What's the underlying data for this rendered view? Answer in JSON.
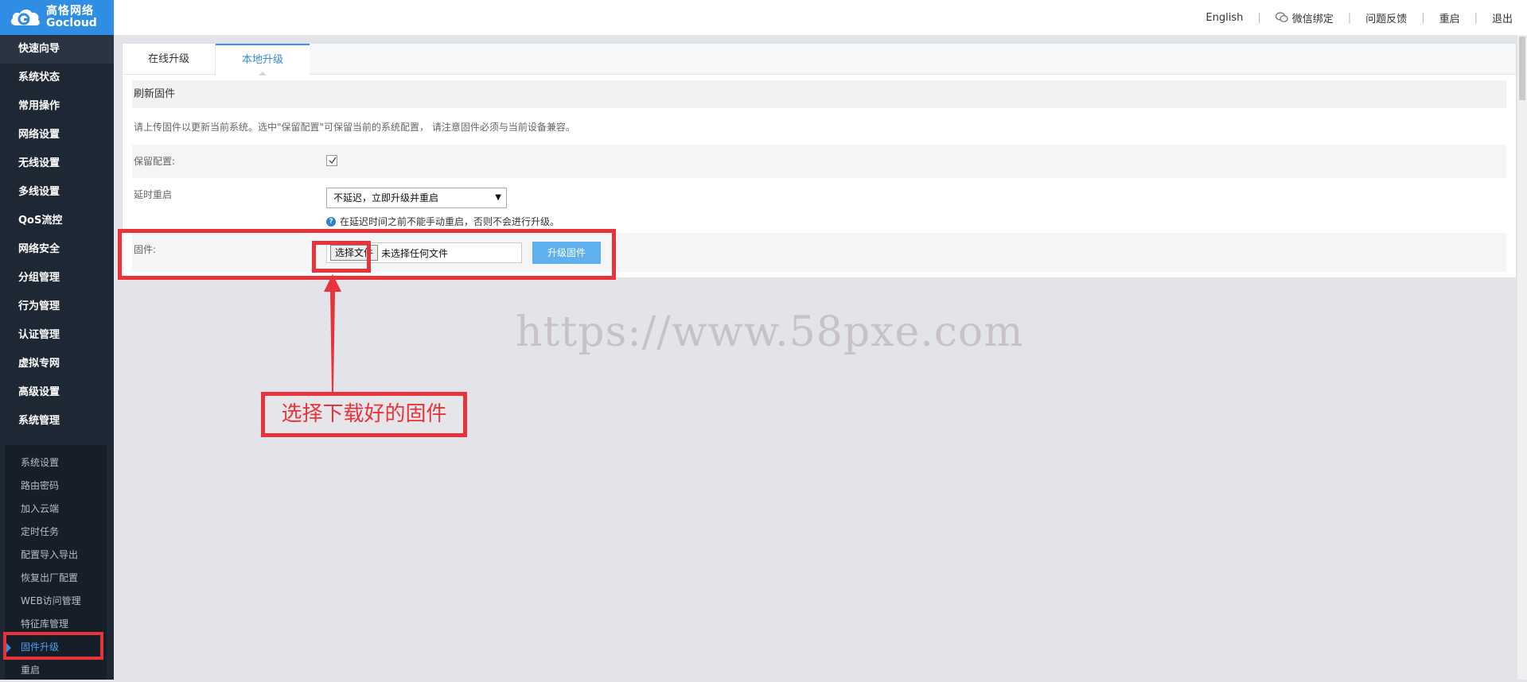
{
  "logo": {
    "cn": "高恪网络",
    "en": "Gocloud"
  },
  "sidebar": {
    "items": [
      {
        "label": "快速向导"
      },
      {
        "label": "系统状态"
      },
      {
        "label": "常用操作"
      },
      {
        "label": "网络设置"
      },
      {
        "label": "无线设置"
      },
      {
        "label": "多线设置"
      },
      {
        "label": "QoS流控"
      },
      {
        "label": "网络安全"
      },
      {
        "label": "分组管理"
      },
      {
        "label": "行为管理"
      },
      {
        "label": "认证管理"
      },
      {
        "label": "虚拟专网"
      },
      {
        "label": "高级设置"
      },
      {
        "label": "系统管理"
      }
    ],
    "subitems": [
      {
        "label": "系统设置"
      },
      {
        "label": "路由密码"
      },
      {
        "label": "加入云端"
      },
      {
        "label": "定时任务"
      },
      {
        "label": "配置导入导出"
      },
      {
        "label": "恢复出厂配置"
      },
      {
        "label": "WEB访问管理"
      },
      {
        "label": "特征库管理"
      },
      {
        "label": "固件升级"
      },
      {
        "label": "重启"
      }
    ]
  },
  "header": {
    "english": "English",
    "wechat": "微信绑定",
    "feedback": "问题反馈",
    "reboot": "重启",
    "logout": "退出",
    "separator": "|"
  },
  "tabs": {
    "online": "在线升级",
    "local": "本地升级"
  },
  "section": {
    "title": "刷新固件",
    "description": "请上传固件以更新当前系统。选中\"保留配置\"可保留当前的系统配置， 请注意固件必须与当前设备兼容。"
  },
  "form": {
    "keep_config_label": "保留配置:",
    "keep_config_checked": true,
    "delay_label": "延时重启",
    "delay_selected": "不延迟，立即升级并重启",
    "delay_hint": "在延迟时间之前不能手动重启，否则不会进行升级。",
    "firmware_label": "固件:",
    "choose_file": "选择文件",
    "no_file": "未选择任何文件",
    "upgrade_button": "升级固件"
  },
  "annotation": {
    "text": "选择下载好的固件",
    "color": "#e8333a"
  },
  "watermark": "https://www.58pxe.com",
  "colors": {
    "accent": "#3a8ee6",
    "sidebar_bg": "#1e2734",
    "logo_bg": "#2f8ee3",
    "button_bg": "#5fb0ee"
  }
}
